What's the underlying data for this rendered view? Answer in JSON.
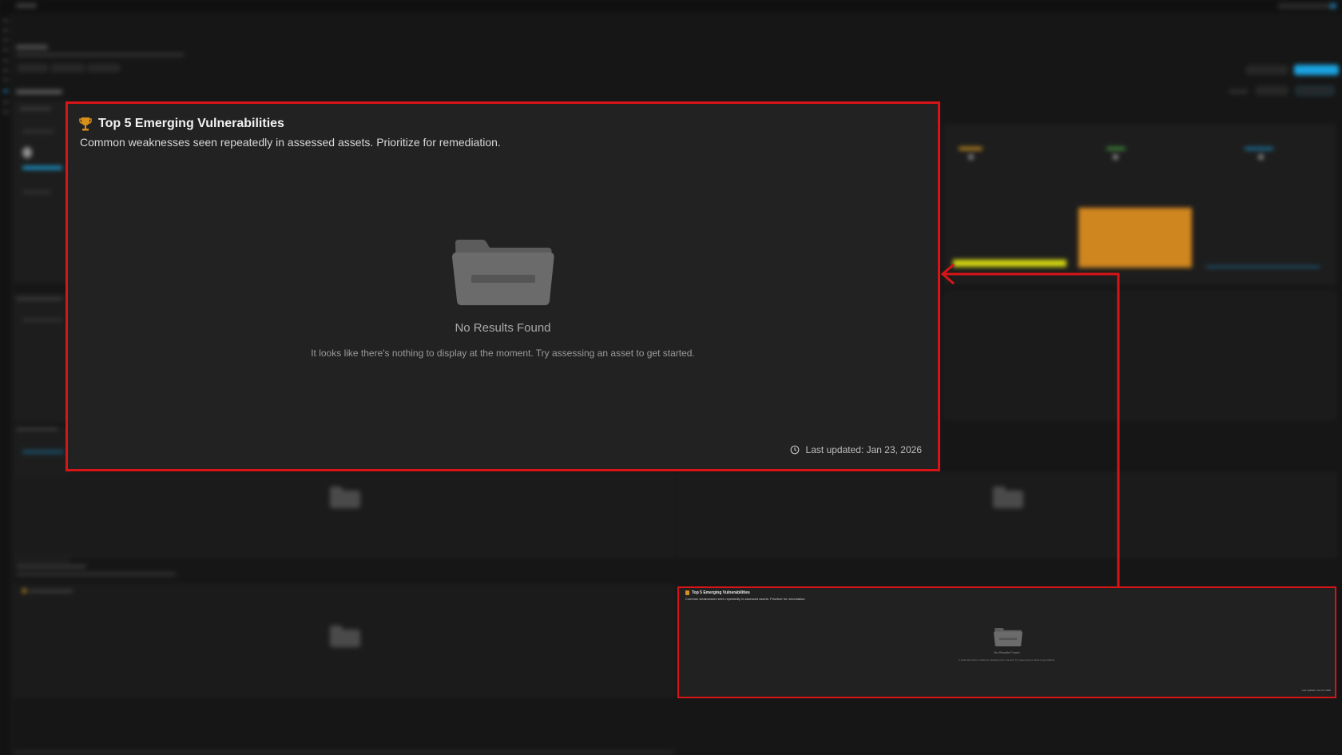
{
  "zoom_card": {
    "title": "Top 5 Emerging Vulnerabilities",
    "subtitle": "Common weaknesses seen repeatedly in assessed assets. Prioritize for remediation.",
    "title_icon": "trophy-icon",
    "empty_state": {
      "icon": "folder-icon",
      "title": "No Results Found",
      "message": "It looks like there's nothing to display at the moment. Try assessing an asset to get started."
    },
    "last_updated": "Last updated: Jan 23, 2026",
    "last_updated_icon": "clock-icon"
  },
  "small_card": {
    "title": "Top 5 Emerging Vulnerabilities",
    "subtitle": "Common weaknesses seen repeatedly in assessed assets. Prioritize for remediation.",
    "empty_title": "No Results Found",
    "empty_message": "It looks like there's nothing to display at the moment. Try assessing an asset to get started.",
    "last_updated": "Last updated: Jan 23, 2026"
  },
  "colors": {
    "highlight_border": "#d81417",
    "accent_orange": "#d8901d",
    "bar_yellow": "#d4d90f",
    "bar_orange": "#d0861f",
    "accent_blue": "#1aa3e0",
    "card_bg": "#222222"
  }
}
